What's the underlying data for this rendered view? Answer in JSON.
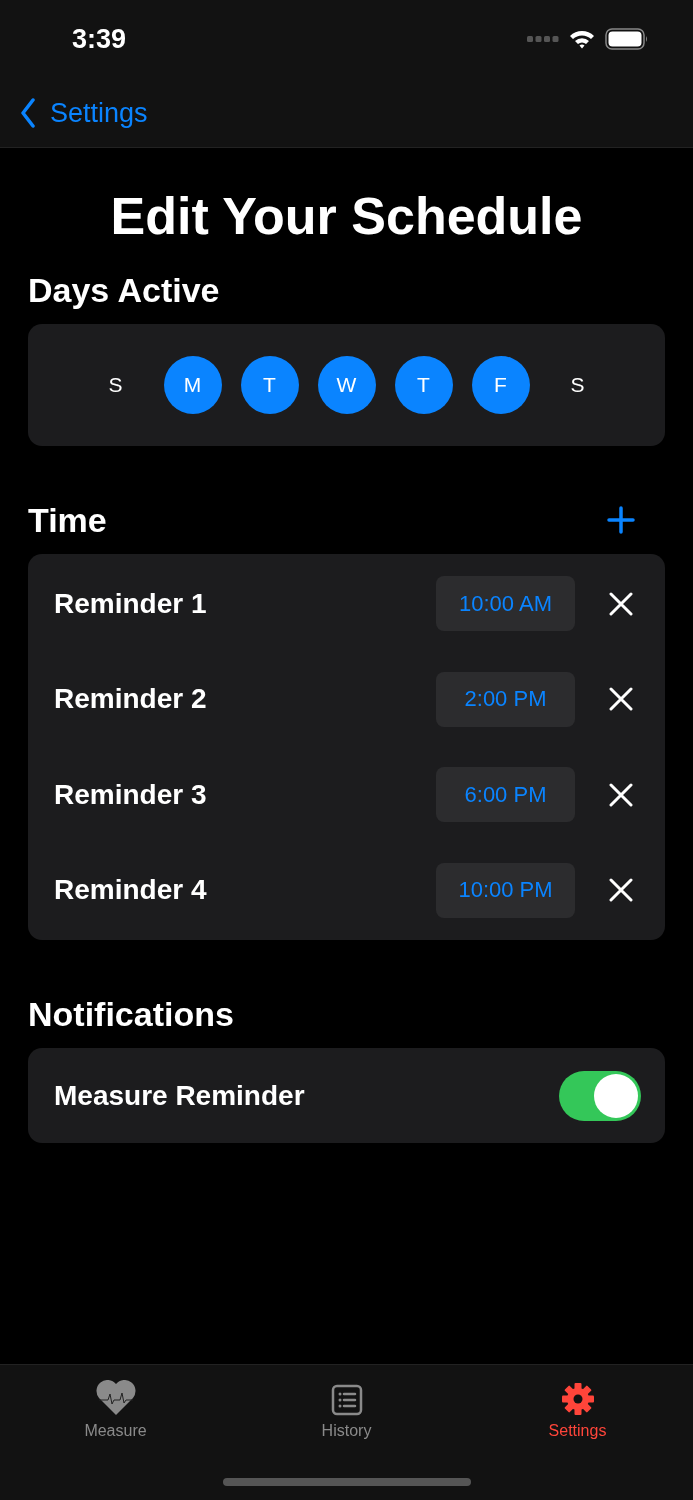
{
  "status_bar": {
    "time": "3:39"
  },
  "nav": {
    "back_label": "Settings"
  },
  "title": "Edit Your Schedule",
  "days_active": {
    "heading": "Days Active",
    "days": [
      {
        "label": "S",
        "selected": false
      },
      {
        "label": "M",
        "selected": true
      },
      {
        "label": "T",
        "selected": true
      },
      {
        "label": "W",
        "selected": true
      },
      {
        "label": "T",
        "selected": true
      },
      {
        "label": "F",
        "selected": true
      },
      {
        "label": "S",
        "selected": false
      }
    ]
  },
  "time": {
    "heading": "Time",
    "reminders": [
      {
        "name": "Reminder 1",
        "time": "10:00 AM"
      },
      {
        "name": "Reminder 2",
        "time": "2:00 PM"
      },
      {
        "name": "Reminder 3",
        "time": "6:00 PM"
      },
      {
        "name": "Reminder 4",
        "time": "10:00 PM"
      }
    ]
  },
  "notifications": {
    "heading": "Notifications",
    "items": [
      {
        "label": "Measure Reminder",
        "on": true
      }
    ]
  },
  "tab_bar": [
    {
      "label": "Measure",
      "selected": false
    },
    {
      "label": "History",
      "selected": false
    },
    {
      "label": "Settings",
      "selected": true
    }
  ]
}
